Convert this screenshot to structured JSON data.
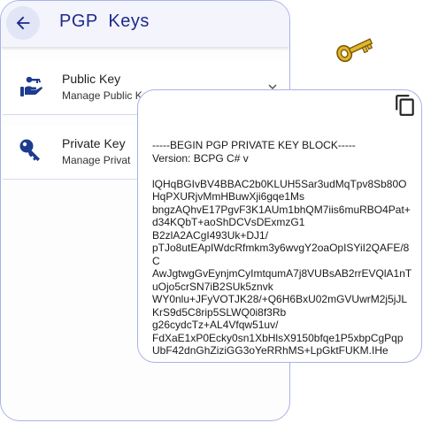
{
  "appbar": {
    "title": "PGP Keys"
  },
  "items": [
    {
      "title": "Public Key",
      "subtitle": "Manage Public Ke"
    },
    {
      "title": "Private Key",
      "subtitle": "Manage Privat"
    }
  ],
  "sheet": {
    "key_text": "-----BEGIN PGP PRIVATE KEY BLOCK-----\nVersion: BCPG C# v\n\nlQHqBGIvBV4BBAC2b0KLUH5Sar3udMqTpv8Sb80OHqPXURjvMmHBuwXji6gqe1Ms\nbngzAQhvE17PgvF3K1AUm1bhQM7iis6muRBO4Pat+d34KQbT+aoShDCVsDExmzG1\nB2zlA2ACgI493Uk+DJ1/\npTJo8utEApIWdcRfmkm3y6wvgY2oaOpISYiI2QAFE/8C\nAwJgtwgGvEynjmCyImtqumA7j8VUBsAB2rrEVQlA1nTuOjo5crSN7iB2SUk5znvk\nWY0nlu+JFyVOTJK28/+Q6H6BxU02mGVUwrM2j5jJLKrS9d5C8rip5SLWQ0i8f3Rb\ng26cydcTz+AL4Vfqw51uv/\nFdXaE1xP0Ecky0sn1XbHlsX9150bfqe1P5xbpCgPqp\nUbF42dnGhZiziGG3oYeRRhMS+LpGktFUKM.IHe"
  },
  "colors": {
    "accent": "#1d2a8c",
    "border": "#aab2e6",
    "appbar_bg": "#f3f4fc",
    "key_gold": "#e1b62a"
  },
  "icons": {
    "back": "arrow-left-icon",
    "public": "hand-holding-key-icon",
    "private": "key-icon",
    "chevron": "chevron-down-icon",
    "copy": "copy-icon",
    "decor": "golden-key-icon"
  }
}
